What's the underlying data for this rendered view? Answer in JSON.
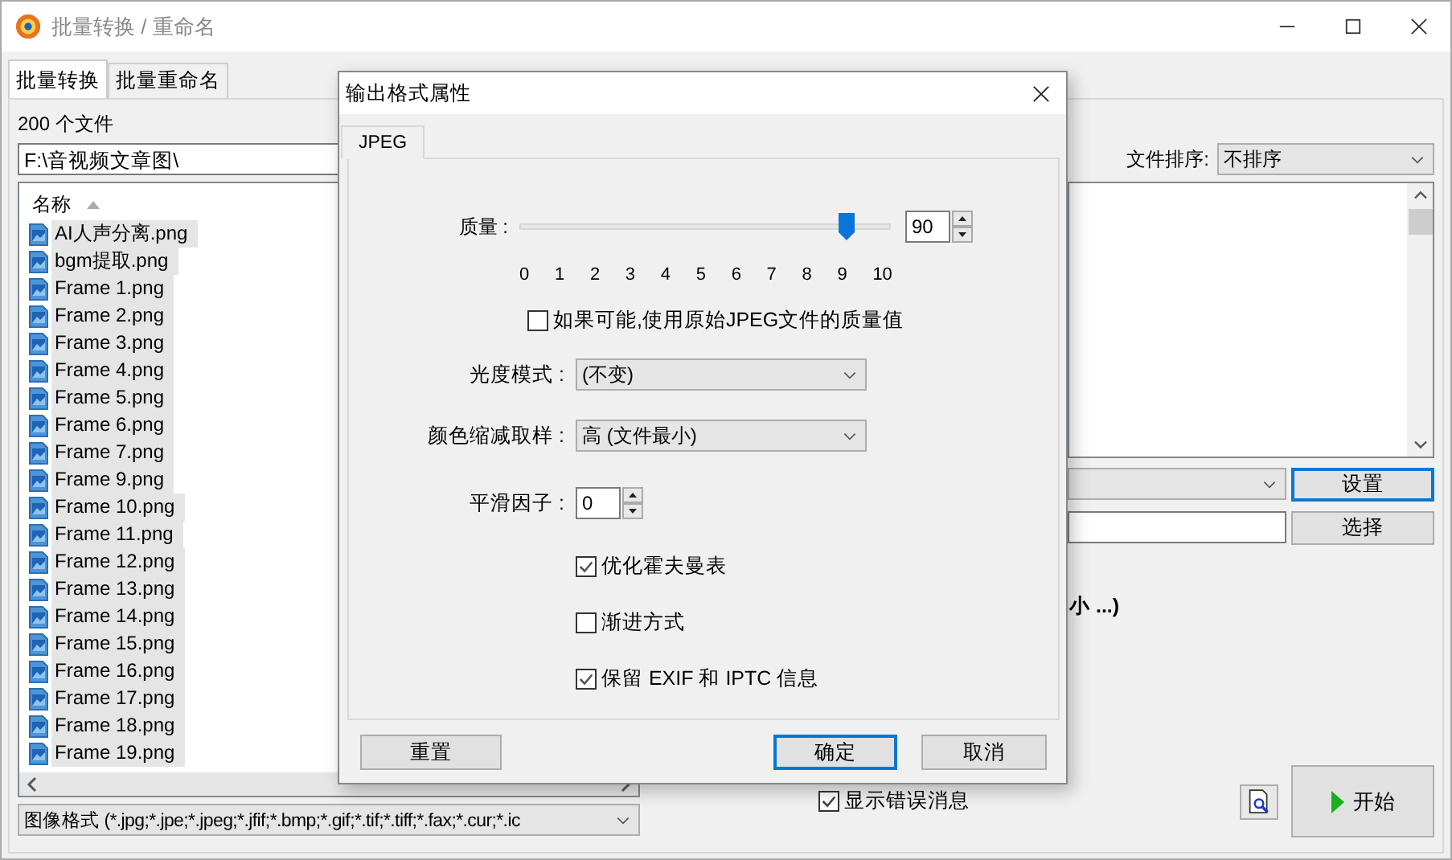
{
  "window": {
    "title": "批量转换 / 重命名"
  },
  "tabs": [
    {
      "label": "批量转换",
      "selected": true
    },
    {
      "label": "批量重命名",
      "selected": false
    }
  ],
  "file_count": "200 个文件",
  "folder_path": "F:\\音视频文章图\\",
  "sort": {
    "label": "文件排序:",
    "value": "不排序"
  },
  "file_list": {
    "column": "名称",
    "files": [
      {
        "name": "AI人声分离.png",
        "selected": true
      },
      {
        "name": "bgm提取.png",
        "selected": true
      },
      {
        "name": "Frame 1.png",
        "selected": true
      },
      {
        "name": "Frame 2.png",
        "selected": true
      },
      {
        "name": "Frame 3.png",
        "selected": true
      },
      {
        "name": "Frame 4.png",
        "selected": true
      },
      {
        "name": "Frame 5.png",
        "selected": true
      },
      {
        "name": "Frame 6.png",
        "selected": true
      },
      {
        "name": "Frame 7.png",
        "selected": true
      },
      {
        "name": "Frame 9.png",
        "selected": true
      },
      {
        "name": "Frame 10.png",
        "selected": true
      },
      {
        "name": "Frame 11.png",
        "selected": true
      },
      {
        "name": "Frame 12.png",
        "selected": true
      },
      {
        "name": "Frame 13.png",
        "selected": true
      },
      {
        "name": "Frame 14.png",
        "selected": true
      },
      {
        "name": "Frame 15.png",
        "selected": true
      },
      {
        "name": "Frame 16.png",
        "selected": true
      },
      {
        "name": "Frame 17.png",
        "selected": true
      },
      {
        "name": "Frame 18.png",
        "selected": true
      },
      {
        "name": "Frame 19.png",
        "selected": true
      }
    ]
  },
  "format_filter": "图像格式 (*.jpg;*.jpe;*.jpeg;*.jfif;*.bmp;*.gif;*.tif;*.tiff;*.fax;*.cur;*.ic",
  "settings_button": "设置",
  "browse_button": "选择",
  "partial_text": "小 ...)",
  "show_errors": {
    "label": "显示错误消息",
    "checked": true
  },
  "start_button": "开始",
  "dialog": {
    "title": "输出格式属性",
    "tab": "JPEG",
    "quality": {
      "label": "质量 :",
      "level": 0.9,
      "value": "90",
      "scale": [
        "0",
        "1",
        "2",
        "3",
        "4",
        "5",
        "6",
        "7",
        "8",
        "9",
        "10"
      ]
    },
    "use_original": {
      "label": "如果可能,使用原始JPEG文件的质量值",
      "checked": false
    },
    "luminance": {
      "label": "光度模式 :",
      "value": "(不变)"
    },
    "subsampling": {
      "label": "颜色缩减取样 :",
      "value": "高 (文件最小)"
    },
    "smoothing": {
      "label": "平滑因子 :",
      "value": "0"
    },
    "options": [
      {
        "label": "优化霍夫曼表",
        "checked": true
      },
      {
        "label": "渐进方式",
        "checked": false
      },
      {
        "label": "保留 EXIF 和 IPTC 信息",
        "checked": true
      }
    ],
    "buttons": [
      {
        "label": "重置",
        "focused": false
      },
      {
        "label": "确定",
        "focused": true
      },
      {
        "label": "取消",
        "focused": false
      }
    ]
  }
}
